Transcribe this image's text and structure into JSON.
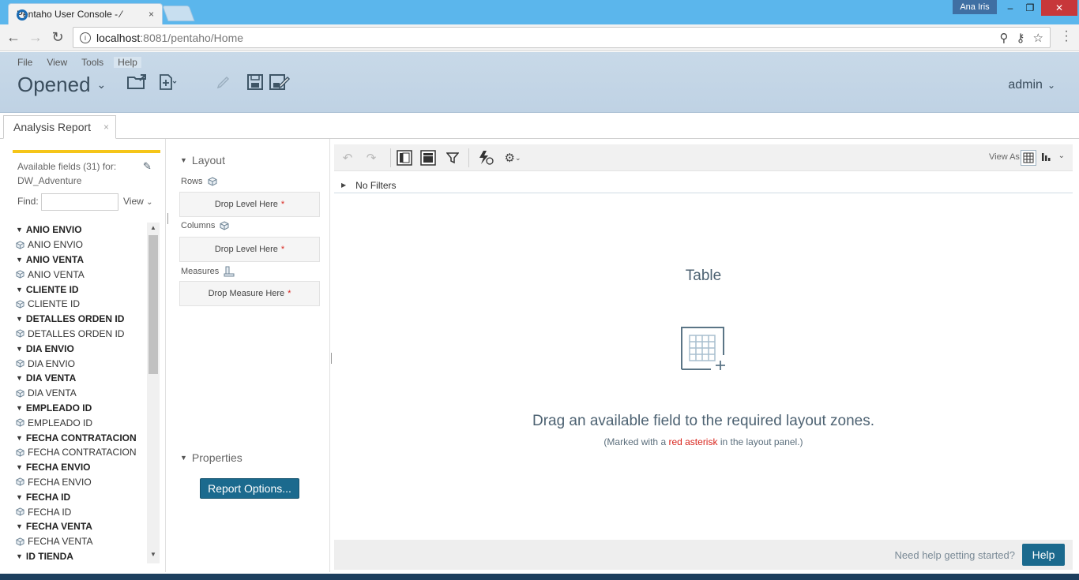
{
  "browser": {
    "tab_title": "Pentaho User Console - ⁄",
    "tab_close": "×",
    "user_badge": "Ana Iris",
    "url_host": "localhost",
    "url_path": ":8081/pentaho/Home",
    "min": "–",
    "max": "❐",
    "close": "✕"
  },
  "menu": {
    "file": "File",
    "view": "View",
    "tools": "Tools",
    "help": "Help"
  },
  "header": {
    "opened": "Opened",
    "admin": "admin"
  },
  "doc_tab": {
    "label": "Analysis Report",
    "close": "×"
  },
  "left": {
    "available_line1": "Available fields (31) for:",
    "available_line2": "DW_Adventure",
    "find_label": "Find:",
    "find_value": "",
    "view_label": "View",
    "fields": [
      {
        "label": "ANIO ENVIO",
        "group": true
      },
      {
        "label": "ANIO ENVIO",
        "group": false
      },
      {
        "label": "ANIO VENTA",
        "group": true
      },
      {
        "label": "ANIO VENTA",
        "group": false
      },
      {
        "label": "CLIENTE ID",
        "group": true
      },
      {
        "label": "CLIENTE ID",
        "group": false
      },
      {
        "label": "DETALLES ORDEN ID",
        "group": true
      },
      {
        "label": "DETALLES ORDEN ID",
        "group": false
      },
      {
        "label": "DIA ENVIO",
        "group": true
      },
      {
        "label": "DIA ENVIO",
        "group": false
      },
      {
        "label": "DIA VENTA",
        "group": true
      },
      {
        "label": "DIA VENTA",
        "group": false
      },
      {
        "label": "EMPLEADO ID",
        "group": true
      },
      {
        "label": "EMPLEADO ID",
        "group": false
      },
      {
        "label": "FECHA CONTRATACION",
        "group": true
      },
      {
        "label": "FECHA CONTRATACION",
        "group": false
      },
      {
        "label": "FECHA ENVIO",
        "group": true
      },
      {
        "label": "FECHA ENVIO",
        "group": false
      },
      {
        "label": "FECHA ID",
        "group": true
      },
      {
        "label": "FECHA ID",
        "group": false
      },
      {
        "label": "FECHA VENTA",
        "group": true
      },
      {
        "label": "FECHA VENTA",
        "group": false
      },
      {
        "label": "ID TIENDA",
        "group": true
      }
    ]
  },
  "layout": {
    "title": "Layout",
    "rows_label": "Rows",
    "rows_drop": "Drop Level Here",
    "columns_label": "Columns",
    "columns_drop": "Drop Level Here",
    "measures_label": "Measures",
    "measures_drop": "Drop Measure Here",
    "asterisk": "*",
    "properties_title": "Properties",
    "report_options": "Report Options..."
  },
  "main": {
    "view_as": "View As:",
    "no_filters": "No Filters",
    "table_title": "Table",
    "drag_msg": "Drag an available field to the required layout zones.",
    "sub_pre": "(Marked with a ",
    "sub_red": "red asterisk",
    "sub_post": " in the layout panel.)",
    "need_help": "Need help getting started?",
    "help_btn": "Help"
  },
  "colors": {
    "titlebar": "#5bb6ec",
    "header": "#c8d9e8",
    "accent_button": "#1b6a8e",
    "asterisk": "#d9241c",
    "yellow_bar": "#f5c518"
  },
  "icons": [
    "back-icon",
    "forward-icon",
    "reload-icon",
    "info-icon",
    "zoom-icon",
    "key-icon",
    "star-icon",
    "menu-icon",
    "open-folder-icon",
    "new-file-icon",
    "save-icon",
    "save-as-icon",
    "edit-icon",
    "cube-icon",
    "measure-icon",
    "undo-icon",
    "redo-icon",
    "layout-icon",
    "field-list-icon",
    "filter-icon",
    "refresh-icon",
    "settings-icon",
    "table-view-icon",
    "chart-view-icon"
  ]
}
